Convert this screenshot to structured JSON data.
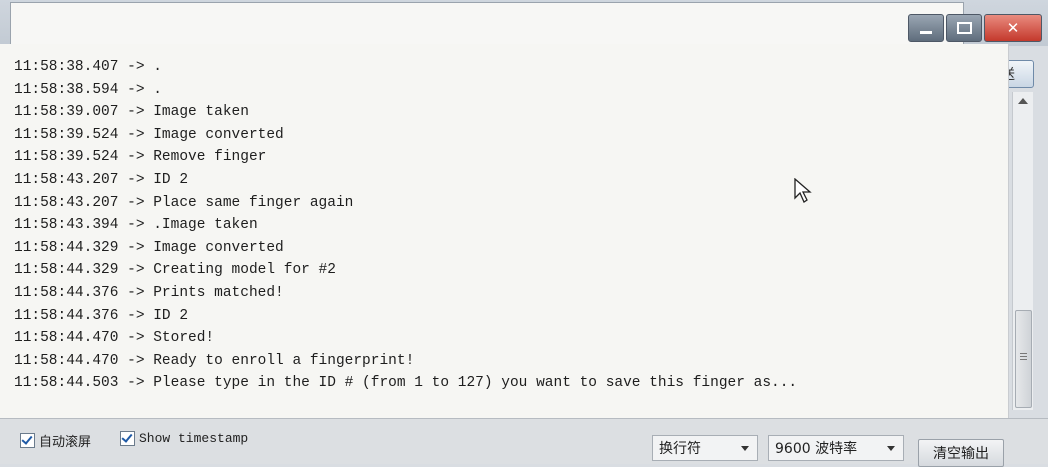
{
  "send": {
    "input_value": "",
    "button_label": "发送"
  },
  "output": {
    "lines": [
      "11:58:38.407 -> .",
      "11:58:38.594 -> .",
      "11:58:39.007 -> Image taken",
      "11:58:39.524 -> Image converted",
      "11:58:39.524 -> Remove finger",
      "11:58:43.207 -> ID 2",
      "11:58:43.207 -> Place same finger again",
      "11:58:43.394 -> .Image taken",
      "11:58:44.329 -> Image converted",
      "11:58:44.329 -> Creating model for #2",
      "11:58:44.376 -> Prints matched!",
      "11:58:44.376 -> ID 2",
      "11:58:44.470 -> Stored!",
      "11:58:44.470 -> Ready to enroll a fingerprint!",
      "11:58:44.503 -> Please type in the ID # (from 1 to 127) you want to save this finger as..."
    ]
  },
  "status": {
    "autoscroll_label": "自动滚屏",
    "autoscroll_checked": true,
    "timestamp_label": "Show timestamp",
    "timestamp_checked": true,
    "line_ending": "换行符",
    "baud_rate": "9600 波特率",
    "clear_label": "清空输出"
  },
  "icons": [
    "minimize-icon",
    "maximize-icon",
    "close-icon",
    "checkbox-check-icon",
    "dropdown-arrow-icon",
    "scroll-up-arrow-icon",
    "mouse-cursor-icon"
  ],
  "colors": {
    "output_bg": "#f6f6f3",
    "close_button": "#c4392c",
    "check_mark": "#1f5aa6"
  }
}
